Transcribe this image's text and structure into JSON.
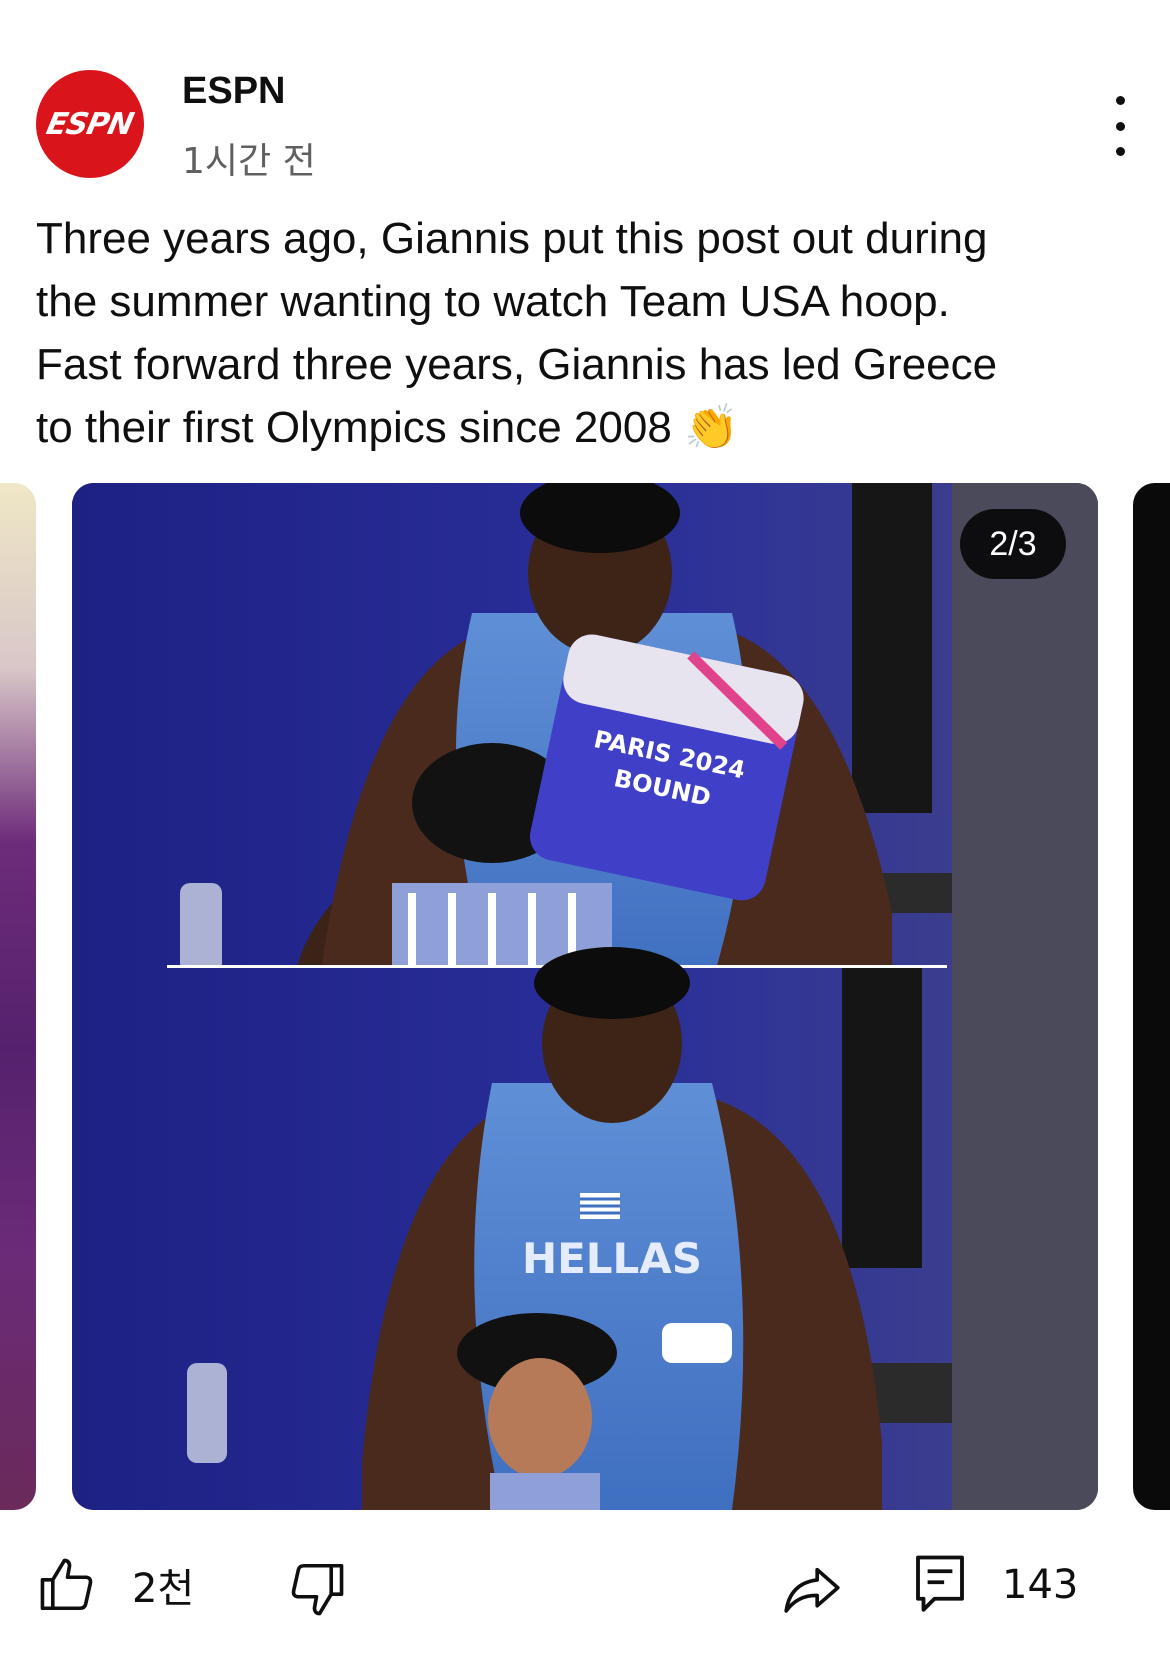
{
  "post": {
    "channel": {
      "name": "ESPN",
      "avatar_logo": "ESPN",
      "brand_color": "#d9141b"
    },
    "time_ago": "1시간 전",
    "more_icon": "more-vertical-icon",
    "text": "Three years ago, Giannis put this post out during\nthe summer wanting to watch Team USA hoop.\nFast forward three years, Giannis has led Greece\nto their first Olympics since 2008 👏",
    "images": {
      "counter": "2/3",
      "current": 2,
      "total": 3,
      "image_text": {
        "sign_line1": "PARIS 2024",
        "sign_line2": "BOUND",
        "jersey": "HELLAS"
      }
    },
    "actions": {
      "like_count": "2천",
      "comment_count": "143",
      "icons": [
        "thumbs-up-icon",
        "thumbs-down-icon",
        "share-icon",
        "comment-icon"
      ]
    }
  }
}
